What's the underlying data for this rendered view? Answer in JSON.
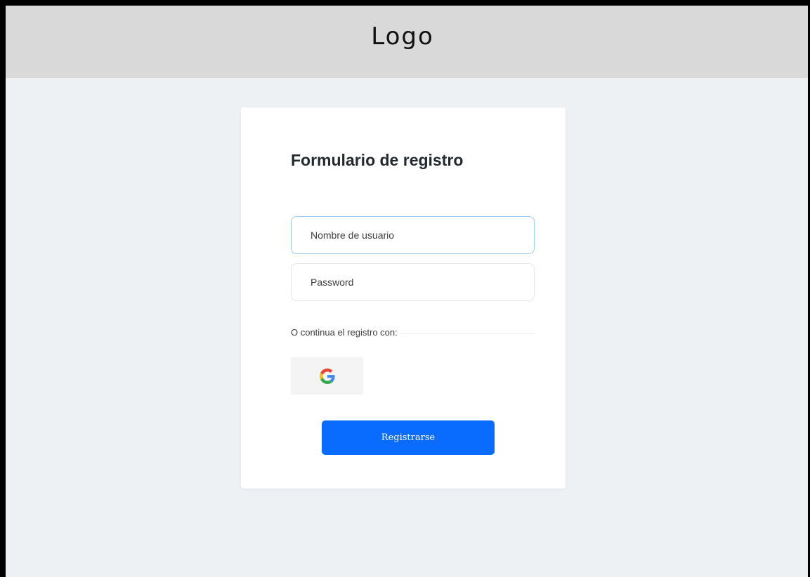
{
  "header": {
    "logo_text": "Logo"
  },
  "form": {
    "title": "Formulario de registro",
    "username_placeholder": "Nombre de usuario",
    "password_placeholder": "Password",
    "divider_text": "O continua el registro con:",
    "google_icon": "google-g-icon",
    "submit_label": "Registrarse"
  },
  "colors": {
    "header_bg": "#d9d9d9",
    "page_bg": "#edf1f4",
    "card_bg": "#ffffff",
    "primary_button": "#0a6cff",
    "focused_border": "#9ec9f0",
    "google_button_bg": "#f4f4f4"
  }
}
